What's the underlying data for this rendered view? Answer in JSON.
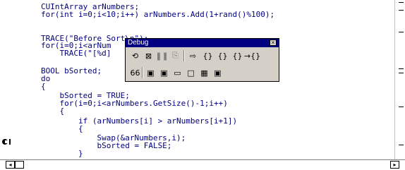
{
  "code": {
    "lines": [
      "CUIntArray arNumbers;",
      "for(int i=0;i<10;i++) arNumbers.Add(1+rand()%100);",
      "",
      "TRACE(\"Before Sort\\n\");",
      "for(i=0;i<arNum",
      "    TRACE(\"[%d]",
      "",
      "BOOL bSorted;",
      "do",
      "{",
      "    bSorted = TRUE;",
      "    for(i=0;i<arNumbers.GetSize()-1;i++)",
      "    {",
      "        if (arNumbers[i] > arNumbers[i+1])",
      "        {",
      "            Swap(&arNumbers,i);",
      "            bSorted = FALSE;",
      "        }"
    ]
  },
  "debug_toolbar": {
    "title": "Debug",
    "close_glyph": "×",
    "row1": [
      {
        "name": "restart-icon",
        "glyph": "⟲",
        "enabled": true
      },
      {
        "name": "stop-debugging-icon",
        "glyph": "⊠",
        "enabled": true
      },
      {
        "name": "break-execution-icon",
        "glyph": "❚❚",
        "enabled": false
      },
      {
        "name": "apply-code-changes-icon",
        "glyph": "⎘",
        "enabled": false
      },
      {
        "name": "show-next-statement-icon",
        "glyph": "⇨",
        "enabled": true
      },
      {
        "name": "step-into-icon",
        "glyph": "{}",
        "enabled": true
      },
      {
        "name": "step-over-icon",
        "glyph": "{}",
        "enabled": true
      },
      {
        "name": "step-out-icon",
        "glyph": "{}",
        "enabled": true
      },
      {
        "name": "run-to-cursor-icon",
        "glyph": "→{}",
        "enabled": true
      }
    ],
    "row2": [
      {
        "name": "quickwatch-icon",
        "glyph": "66",
        "enabled": true
      },
      {
        "name": "watch-window-icon",
        "glyph": "▣",
        "enabled": true
      },
      {
        "name": "variables-window-icon",
        "glyph": "▣",
        "enabled": true
      },
      {
        "name": "registers-window-icon",
        "glyph": "▭",
        "enabled": true
      },
      {
        "name": "memory-window-icon",
        "glyph": "□",
        "enabled": true
      },
      {
        "name": "call-stack-window-icon",
        "glyph": "▦",
        "enabled": true
      },
      {
        "name": "disassembly-window-icon",
        "glyph": "▣",
        "enabled": true
      }
    ]
  },
  "scroll": {
    "left_arrow": "◂",
    "right_arrow": "▸"
  },
  "gutter": {
    "current_line_marker_glyph": "➲"
  },
  "colors": {
    "code_text": "#000080",
    "toolbar_face": "#d4d0c8",
    "title_bar": "#000080"
  }
}
